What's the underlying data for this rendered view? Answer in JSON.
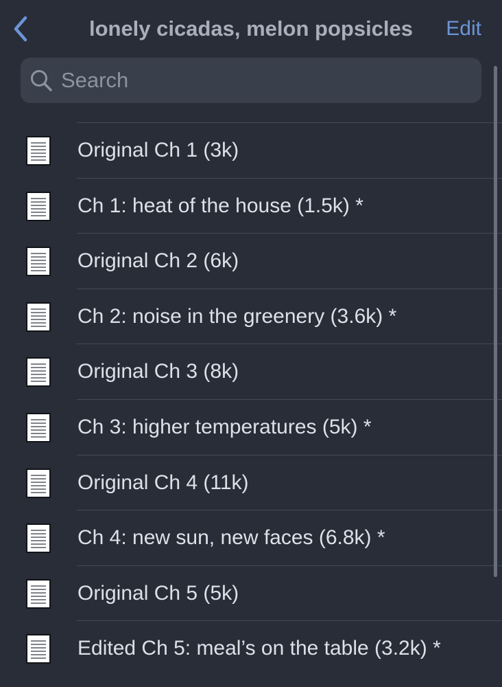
{
  "navbar": {
    "title": "lonely cicadas, melon popsicles",
    "edit_label": "Edit",
    "back_icon": "chevron-left-icon",
    "accent_color": "#6d94d6"
  },
  "search": {
    "placeholder": "Search",
    "icon": "search-icon"
  },
  "documents": [
    {
      "label": "Original Ch 1 (3k)",
      "icon": "document-icon"
    },
    {
      "label": "Ch 1: heat of the house (1.5k) *",
      "icon": "document-icon"
    },
    {
      "label": "Original Ch 2 (6k)",
      "icon": "document-icon"
    },
    {
      "label": "Ch 2: noise in the greenery (3.6k) *",
      "icon": "document-icon"
    },
    {
      "label": "Original Ch 3 (8k)",
      "icon": "document-icon"
    },
    {
      "label": "Ch 3: higher temperatures (5k) *",
      "icon": "document-icon"
    },
    {
      "label": "Original Ch 4 (11k)",
      "icon": "document-icon"
    },
    {
      "label": "Ch 4: new sun, new faces (6.8k) *",
      "icon": "document-icon"
    },
    {
      "label": "Original Ch 5 (5k)",
      "icon": "document-icon"
    },
    {
      "label": "Edited Ch 5: meal’s on the table (3.2k) *",
      "icon": "document-icon"
    }
  ]
}
